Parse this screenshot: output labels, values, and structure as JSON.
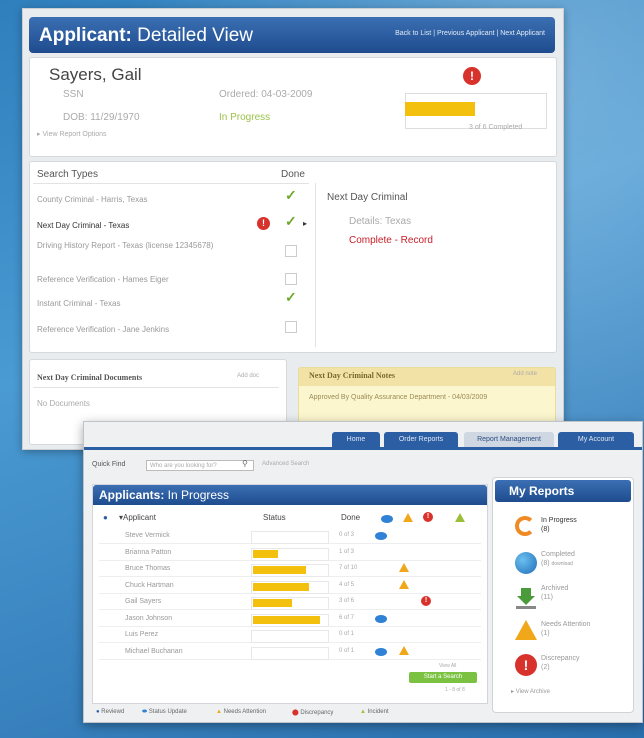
{
  "detail": {
    "title_bold": "Applicant:",
    "title_rest": " Detailed View",
    "nav": "Back to List | Previous Applicant | Next Applicant",
    "name": "Sayers, Gail",
    "ssn_label": "SSN",
    "dob": "DOB: 11/29/1970",
    "ordered": "Ordered: 04-03-2009",
    "status": "In Progress",
    "view_options": "View Report Options",
    "progress_label": "3 of 6 Completed",
    "progress_fraction": 0.5
  },
  "search": {
    "header": "Search Types",
    "done_header": "Done",
    "items": [
      {
        "label": "County Criminal - Harris, Texas",
        "done": true
      },
      {
        "label": "Next Day Criminal - Texas",
        "done": true,
        "selected": true
      },
      {
        "label": "Driving History Report - Texas (license 12345678)",
        "done": false
      },
      {
        "label": "Reference Verification - Hames Eiger",
        "done": false
      },
      {
        "label": "Instant Criminal - Texas",
        "done": true
      },
      {
        "label": "Reference Verification - Jane Jenkins",
        "done": false
      }
    ]
  },
  "detail_panel": {
    "title": "Next Day Criminal",
    "details": "Details: Texas",
    "result": "Complete - Record"
  },
  "documents": {
    "title": "Next Day Criminal Documents",
    "add": "Add doc",
    "empty": "No Documents"
  },
  "notes": {
    "title": "Next Day Criminal Notes",
    "add": "Add note",
    "text": "Approved By Quality Assurance Department - 04/03/2009"
  },
  "tabs": [
    "Home",
    "Order Reports",
    "Report Management",
    "My Account"
  ],
  "quick_find": {
    "label": "Quick Find",
    "placeholder": "Who are you looking for?",
    "advanced": "Advanced Search"
  },
  "list": {
    "title_bold": "Applicants:",
    "title_rest": " In Progress",
    "columns": {
      "applicant": "Applicant",
      "status": "Status",
      "done": "Done"
    },
    "rows": [
      {
        "name": "Steve Vermick",
        "progress": 0.0,
        "done": "0 of 3",
        "message": true,
        "alert": false,
        "discrepancy": false
      },
      {
        "name": "Brianna Patton",
        "progress": 0.35,
        "done": "1 of 3",
        "message": false,
        "alert": false,
        "discrepancy": false
      },
      {
        "name": "Bruce Thomas",
        "progress": 0.75,
        "done": "7 of 10",
        "message": false,
        "alert": true,
        "discrepancy": false
      },
      {
        "name": "Chuck Hartman",
        "progress": 0.8,
        "done": "4 of 5",
        "message": false,
        "alert": true,
        "discrepancy": false
      },
      {
        "name": "Gail Sayers",
        "progress": 0.55,
        "done": "3 of 6",
        "message": false,
        "alert": false,
        "discrepancy": true
      },
      {
        "name": "Jason Johnson",
        "progress": 0.95,
        "done": "6 of 7",
        "message": true,
        "alert": false,
        "discrepancy": false
      },
      {
        "name": "Luis Perez",
        "progress": 0.0,
        "done": "0 of 1",
        "message": false,
        "alert": false,
        "discrepancy": false
      },
      {
        "name": "Michael Buchanan",
        "progress": 0.0,
        "done": "0 of 1",
        "message": true,
        "alert": true,
        "discrepancy": false
      }
    ],
    "view_all": "View All",
    "button": "Start a Search",
    "count": "1 - 8 of 8"
  },
  "my_reports": {
    "title": "My Reports",
    "items": [
      {
        "label": "In Progress",
        "count": "(8)",
        "icon": "refresh-icon",
        "color": "#f08a24"
      },
      {
        "label": "Completed",
        "count": "(8)",
        "extra": "download",
        "icon": "globe-icon",
        "color": "#2f8ad6"
      },
      {
        "label": "Archived",
        "count": "(11)",
        "icon": "archive-download-icon",
        "color": "#4a9b3a"
      },
      {
        "label": "Needs Attention",
        "count": "(1)",
        "icon": "warning-icon",
        "color": "#f0a71a"
      },
      {
        "label": "Discrepancy",
        "count": "(2)",
        "icon": "stop-icon",
        "color": "#d8322c"
      }
    ],
    "view_archive": "View Archive"
  },
  "legend": [
    "Reviewd",
    "Status Update",
    "Needs Attention",
    "Discrepancy",
    "Incident"
  ]
}
